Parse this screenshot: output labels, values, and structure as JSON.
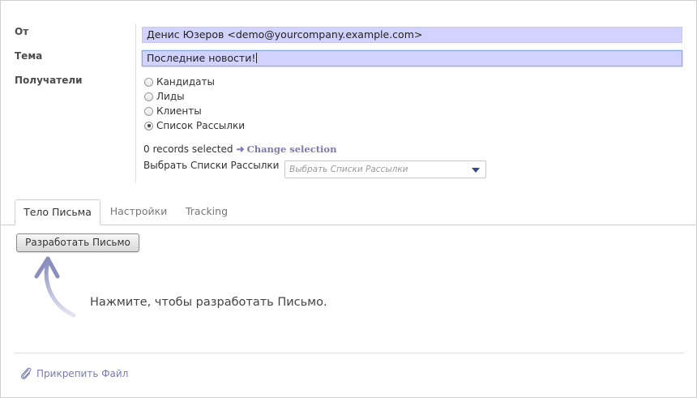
{
  "form": {
    "from_label": "От",
    "from_value": "Денис Юзеров <demo@yourcompany.example.com>",
    "subject_label": "Тема",
    "subject_value": "Последние новости!",
    "recipients_label": "Получатели",
    "recipient_options": [
      {
        "label": "Кандидаты",
        "selected": false
      },
      {
        "label": "Лиды",
        "selected": false
      },
      {
        "label": "Клиенты",
        "selected": false
      },
      {
        "label": "Список Рассылки",
        "selected": true
      }
    ],
    "records_selected": "0 records selected",
    "change_selection": "Change selection",
    "mailing_lists_label": "Выбрать Списки Рассылки",
    "mailing_lists_placeholder": "Выбрать Списки Рассылки"
  },
  "tabs": [
    {
      "label": "Тело Письма",
      "active": true
    },
    {
      "label": "Настройки",
      "active": false
    },
    {
      "label": "Tracking",
      "active": false
    }
  ],
  "body": {
    "design_button": "Разработать Письмо",
    "hint": "Нажмите, чтобы разработать Письмо."
  },
  "attachments": {
    "attach_label": "Прикрепить Файл"
  },
  "icons": {
    "change_arrow": "right-arrow-icon",
    "attach": "paperclip-icon",
    "hint_arrow": "curved-up-arrow-icon"
  },
  "colors": {
    "field_bg": "#d2d2ff",
    "link": "#7c7bad"
  }
}
